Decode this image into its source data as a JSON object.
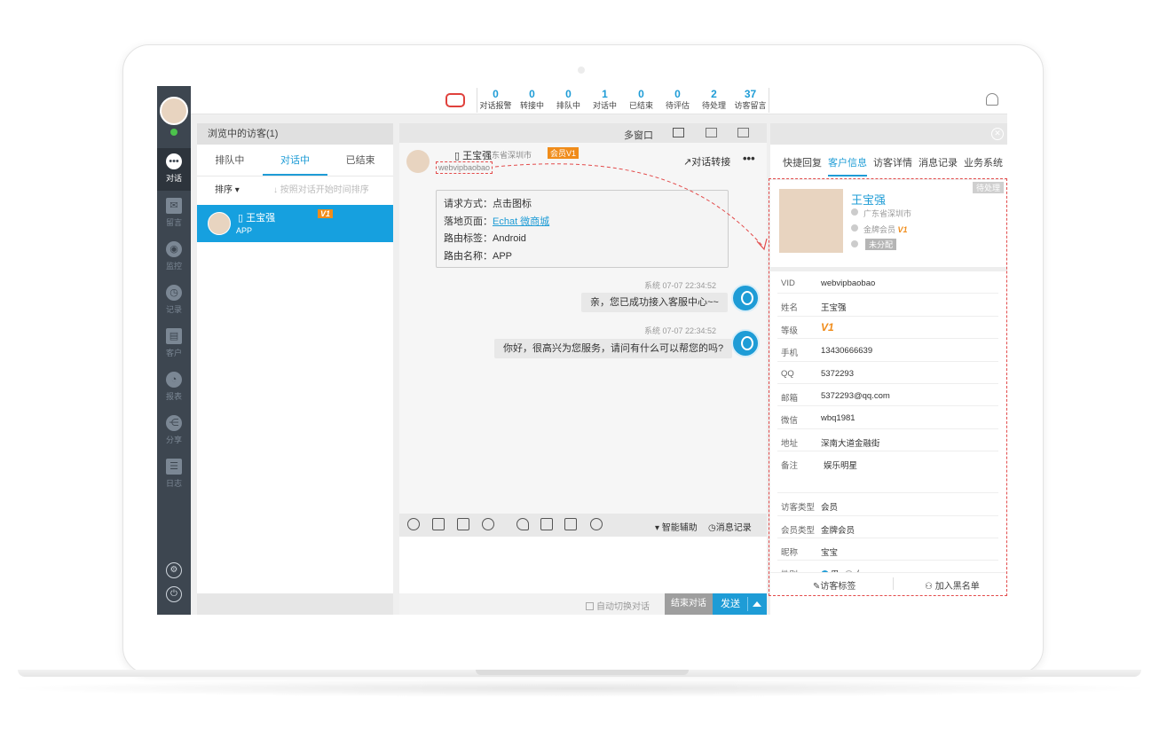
{
  "stats": [
    {
      "count": "0",
      "label": "对话报警"
    },
    {
      "count": "0",
      "label": "转接中"
    },
    {
      "count": "0",
      "label": "排队中"
    },
    {
      "count": "1",
      "label": "对话中"
    },
    {
      "count": "0",
      "label": "已结束"
    },
    {
      "count": "0",
      "label": "待评估"
    },
    {
      "count": "2",
      "label": "待处理"
    },
    {
      "count": "37",
      "label": "访客留言"
    }
  ],
  "nav": {
    "items": [
      {
        "label": "对话",
        "icon": "chat-icon"
      },
      {
        "label": "留言",
        "icon": "mail-icon"
      },
      {
        "label": "监控",
        "icon": "eye-icon"
      },
      {
        "label": "记录",
        "icon": "clock-icon"
      },
      {
        "label": "客户",
        "icon": "id-card-icon"
      },
      {
        "label": "报表",
        "icon": "pie-chart-icon"
      },
      {
        "label": "分享",
        "icon": "share-icon"
      },
      {
        "label": "日志",
        "icon": "clipboard-icon"
      }
    ]
  },
  "visitors": {
    "header": "浏览中的访客(1)",
    "tabs": [
      "排队中",
      "对话中",
      "已结束"
    ],
    "sort_label": "排序 ▾",
    "sort_hint": "↓ 按照对话开始时间排序",
    "row": {
      "name": "王宝强",
      "sub": "APP",
      "badge": "V1"
    }
  },
  "chat": {
    "multi_window": "多窗口",
    "visitor_name": "王宝强",
    "location": "广东省深圳市",
    "member_badge": "会员V1",
    "vid": "webvipbaobao",
    "transfer": "↗对话转接",
    "more": "•••",
    "request": {
      "line1_label": "请求方式：",
      "line1_value": "点击图标",
      "line2_label": "落地页面：",
      "line2_value": "Echat 微商城",
      "line3_label": "路由标签：",
      "line3_value": "Android",
      "line4_label": "路由名称：",
      "line4_value": "APP"
    },
    "messages": [
      {
        "time": "系统 07-07 22:34:52",
        "text": "亲，您已成功接入客服中心~~"
      },
      {
        "time": "系统 07-07 22:34:52",
        "text": "你好，很高兴为您服务，请问有什么可以帮您的吗?"
      }
    ],
    "toolbar": {
      "assist": "▾ 智能辅助",
      "history": "◷消息记录"
    },
    "auto_switch": "自动切换对话",
    "end_button": "结束对话",
    "send_button": "发送"
  },
  "customer": {
    "tabs": [
      "快捷回复",
      "客户信息",
      "访客详情",
      "消息记录",
      "业务系统"
    ],
    "name": "王宝强",
    "location": "广东省深圳市",
    "level_text": "金牌会员",
    "level_badge": "V1",
    "assign": "未分配",
    "pending": "待处理",
    "fields": [
      {
        "key": "VID",
        "value": "webvipbaobao"
      },
      {
        "key": "姓名",
        "value": "王宝强"
      },
      {
        "key": "等级",
        "value": "V1"
      },
      {
        "key": "手机",
        "value": "13430666639"
      },
      {
        "key": "QQ",
        "value": "5372293"
      },
      {
        "key": "邮箱",
        "value": "5372293@qq.com"
      },
      {
        "key": "微信",
        "value": "wbq1981"
      },
      {
        "key": "地址",
        "value": "深南大道金融街"
      },
      {
        "key": "备注",
        "value": "娱乐明星"
      },
      {
        "key": "访客类型",
        "value": "会员"
      },
      {
        "key": "会员类型",
        "value": "金牌会员"
      },
      {
        "key": "昵称",
        "value": "宝宝"
      },
      {
        "key": "性别",
        "value": ""
      }
    ],
    "gender_male": "男",
    "gender_female": "女",
    "tag_button": "✎访客标签",
    "blacklist_button": "⚇ 加入黑名单"
  },
  "colors": {
    "accent": "#1e9cd6",
    "nav_bg": "#3d4650",
    "vip_orange": "#f08c1a",
    "annotation_red": "#e34b4b"
  }
}
